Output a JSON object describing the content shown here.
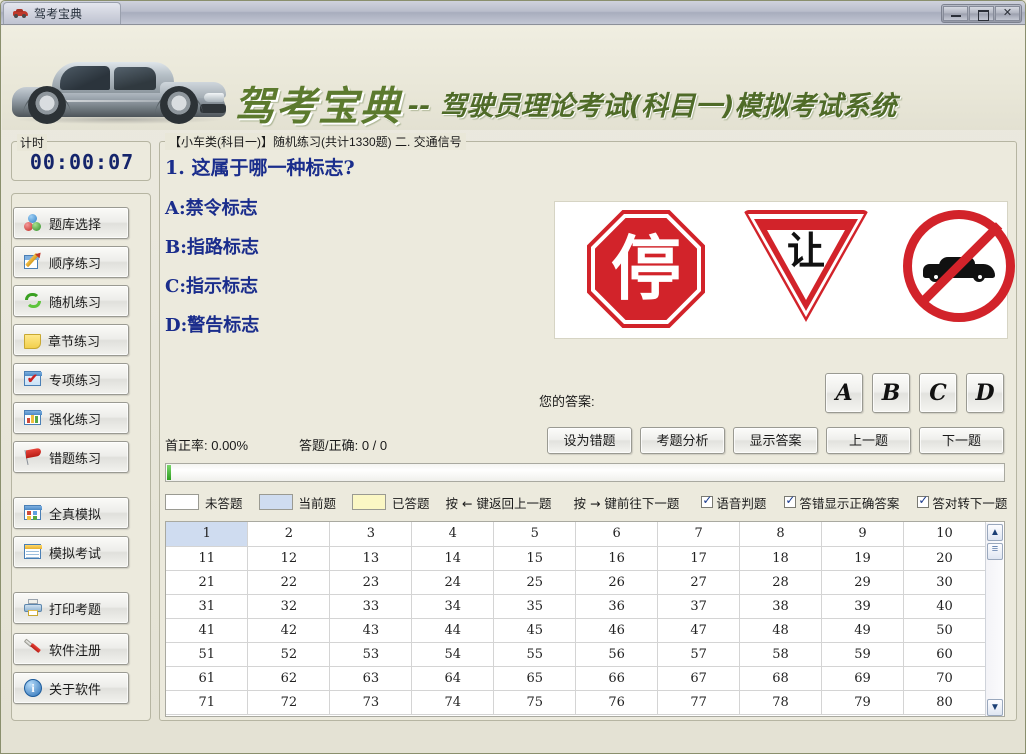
{
  "window": {
    "title": "驾考宝典",
    "titlebar_icon": "car-icon",
    "buttons": {
      "minimize": "minimize-icon",
      "maximize": "maximize-icon",
      "close": "close-icon"
    }
  },
  "banner": {
    "brand": "驾考宝典",
    "subtitle": "-- 驾驶员理论考试(科目一)模拟考试系统",
    "car_image": "sedan-car-photo"
  },
  "timer": {
    "legend": "计时",
    "value": "00:00:07"
  },
  "sidebar": {
    "items": [
      {
        "label": "题库选择",
        "icon": "balls-icon"
      },
      {
        "label": "顺序练习",
        "icon": "pencil-icon"
      },
      {
        "label": "随机练习",
        "icon": "recycle-icon"
      },
      {
        "label": "章节练习",
        "icon": "note-icon"
      },
      {
        "label": "专项练习",
        "icon": "checkmark-window-icon"
      },
      {
        "label": "强化练习",
        "icon": "barchart-icon"
      },
      {
        "label": "错题练习",
        "icon": "red-flag-icon"
      },
      {
        "label": "全真模拟",
        "icon": "grid-window-icon"
      },
      {
        "label": "模拟考试",
        "icon": "calendar-icon"
      },
      {
        "label": "打印考题",
        "icon": "printer-icon"
      },
      {
        "label": "软件注册",
        "icon": "screwdriver-icon"
      },
      {
        "label": "关于软件",
        "icon": "info-icon"
      }
    ]
  },
  "main": {
    "legend": "【小车类(科目一)】随机练习(共计1330题) 二. 交通信号",
    "question": {
      "title": "1. 这属于哪一种标志?",
      "options": [
        "A:禁令标志",
        "B:指路标志",
        "C:指示标志",
        "D:警告标志"
      ],
      "image": {
        "name": "traffic-signs-image",
        "signs": [
          {
            "type": "stop-sign",
            "glyph": "停"
          },
          {
            "type": "yield-sign",
            "glyph": "让"
          },
          {
            "type": "no-motor-vehicles-sign",
            "glyph": "car-crossed"
          }
        ]
      }
    },
    "answer": {
      "label": "您的答案:",
      "choices": [
        "A",
        "B",
        "C",
        "D"
      ],
      "selected": ""
    },
    "stats": {
      "rate": "首正率: 0.00%",
      "count": "答题/正确: 0 / 0",
      "progress_percent": 0
    },
    "actions": [
      "设为错题",
      "考题分析",
      "显示答案",
      "上一题",
      "下一题"
    ],
    "legend_row": {
      "swatches": [
        {
          "label": "未答题",
          "color": "#ffffff"
        },
        {
          "label": "当前题",
          "color": "#cfdcf0"
        },
        {
          "label": "已答题",
          "color": "#fbf7c4"
        }
      ],
      "hint_prev": "按 ← 键返回上一题",
      "hint_next": "按 → 键前往下一题",
      "checkboxes": [
        {
          "label": "语音判题",
          "checked": true
        },
        {
          "label": "答错显示正确答案",
          "checked": true
        },
        {
          "label": "答对转下一题",
          "checked": true
        }
      ]
    },
    "grid": {
      "current": 1,
      "rows": [
        [
          1,
          2,
          3,
          4,
          5,
          6,
          7,
          8,
          9,
          10
        ],
        [
          11,
          12,
          13,
          14,
          15,
          16,
          17,
          18,
          19,
          20
        ],
        [
          21,
          22,
          23,
          24,
          25,
          26,
          27,
          28,
          29,
          30
        ],
        [
          31,
          32,
          33,
          34,
          35,
          36,
          37,
          38,
          39,
          40
        ],
        [
          41,
          42,
          43,
          44,
          45,
          46,
          47,
          48,
          49,
          50
        ],
        [
          51,
          52,
          53,
          54,
          55,
          56,
          57,
          58,
          59,
          60
        ],
        [
          61,
          62,
          63,
          64,
          65,
          66,
          67,
          68,
          69,
          70
        ],
        [
          71,
          72,
          73,
          74,
          75,
          76,
          77,
          78,
          79,
          80
        ]
      ],
      "scrollbar": {
        "up": "▲",
        "down": "▼"
      }
    }
  },
  "colors": {
    "app_background": "#e9e7d8",
    "panel_background": "#eceadd",
    "brand_green": "#5c7a2e",
    "question_blue": "#1a2d8c",
    "timer_navy": "#15256b",
    "sign_red": "#d2232a",
    "current_cell": "#cfdcf0",
    "answered_cell": "#fbf7c4"
  }
}
